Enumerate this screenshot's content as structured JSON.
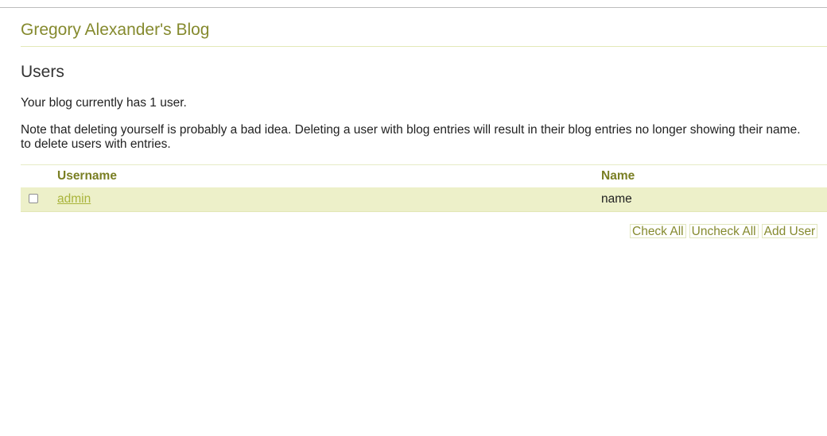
{
  "header": {
    "blog_title": "Gregory Alexander's Blog"
  },
  "section": {
    "heading": "Users",
    "summary": "Your blog currently has 1 user.",
    "note_line1": "Note that deleting yourself is probably a bad idea. Deleting a user with blog entries will result in their blog entries no longer showing their name.",
    "note_line2": "to delete users with entries."
  },
  "table": {
    "columns": [
      "Username",
      "Name"
    ],
    "rows": [
      {
        "username": "admin",
        "name": "name",
        "checked": false
      }
    ]
  },
  "actions": {
    "check_all": "Check All",
    "uncheck_all": "Uncheck All",
    "add_user": "Add User"
  },
  "colors": {
    "accent": "#858a2e",
    "link": "#a9b43b",
    "row_highlight": "#edf0c9"
  }
}
